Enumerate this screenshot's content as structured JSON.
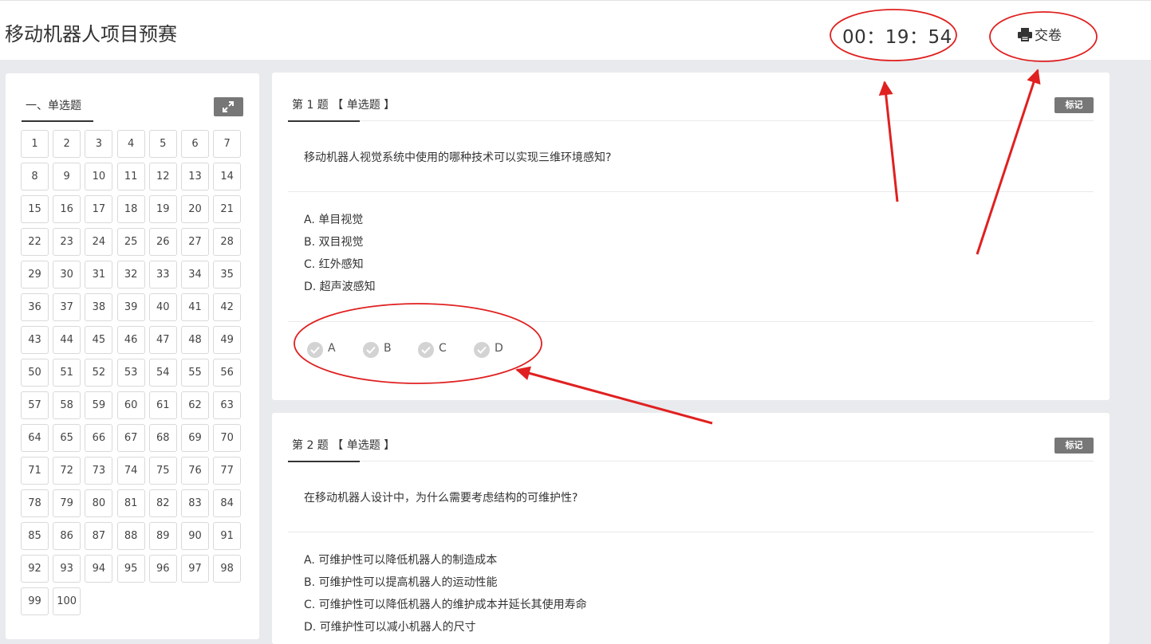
{
  "header": {
    "title": "移动机器人项目预赛",
    "timer": "00：19：54",
    "submit_label": "交卷"
  },
  "sidebar": {
    "section_title": "一、单选题",
    "numbers": [
      "1",
      "2",
      "3",
      "4",
      "5",
      "6",
      "7",
      "8",
      "9",
      "10",
      "11",
      "12",
      "13",
      "14",
      "15",
      "16",
      "17",
      "18",
      "19",
      "20",
      "21",
      "22",
      "23",
      "24",
      "25",
      "26",
      "27",
      "28",
      "29",
      "30",
      "31",
      "32",
      "33",
      "34",
      "35",
      "36",
      "37",
      "38",
      "39",
      "40",
      "41",
      "42",
      "43",
      "44",
      "45",
      "46",
      "47",
      "48",
      "49",
      "50",
      "51",
      "52",
      "53",
      "54",
      "55",
      "56",
      "57",
      "58",
      "59",
      "60",
      "61",
      "62",
      "63",
      "64",
      "65",
      "66",
      "67",
      "68",
      "69",
      "70",
      "71",
      "72",
      "73",
      "74",
      "75",
      "76",
      "77",
      "78",
      "79",
      "80",
      "81",
      "82",
      "83",
      "84",
      "85",
      "86",
      "87",
      "88",
      "89",
      "90",
      "91",
      "92",
      "93",
      "94",
      "95",
      "96",
      "97",
      "98",
      "99",
      "100"
    ]
  },
  "questions": [
    {
      "header": "第 1 题 【 单选题 】",
      "mark_label": "标记",
      "stem": "移动机器人视觉系统中使用的哪种技术可以实现三维环境感知?",
      "options": [
        "A. 单目视觉",
        "B. 双目视觉",
        "C. 红外感知",
        "D. 超声波感知"
      ],
      "answer_choices": [
        "A",
        "B",
        "C",
        "D"
      ]
    },
    {
      "header": "第 2 题 【 单选题 】",
      "mark_label": "标记",
      "stem": "在移动机器人设计中，为什么需要考虑结构的可维护性?",
      "options": [
        "A. 可维护性可以降低机器人的制造成本",
        "B. 可维护性可以提高机器人的运动性能",
        "C. 可维护性可以降低机器人的维护成本并延长其使用寿命",
        "D. 可维护性可以减小机器人的尺寸"
      ]
    }
  ],
  "icons": {
    "submit": "printer-icon",
    "expand": "expand-icon",
    "check": "check-icon"
  },
  "colors": {
    "background": "#e9eaed",
    "dark_button": "#777777",
    "annotation": "#e02020"
  }
}
